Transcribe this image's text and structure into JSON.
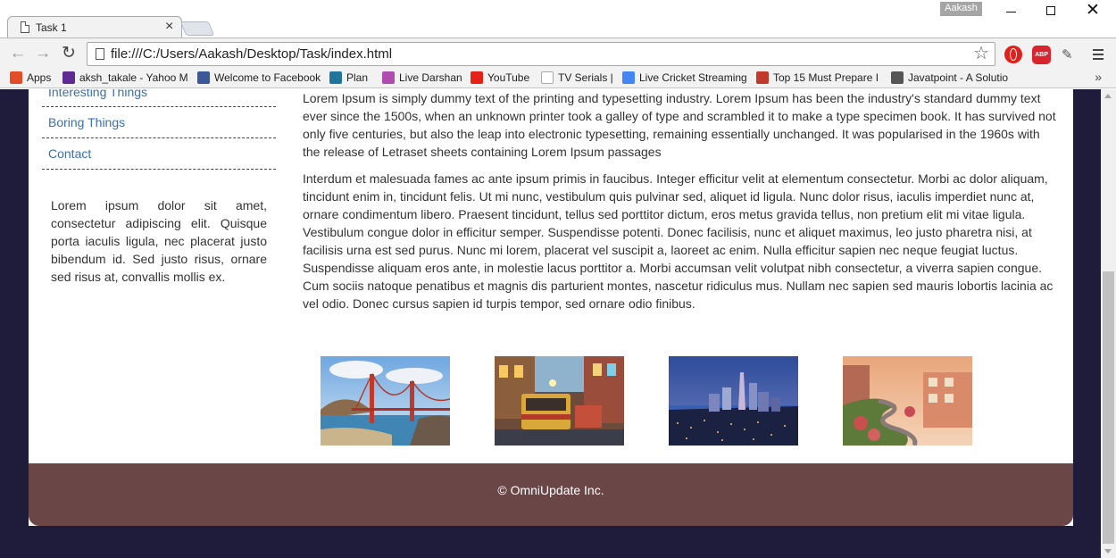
{
  "browser": {
    "tab_title": "Task 1",
    "profile_name": "Aakash",
    "url": "file:///C:/Users/Aakash/Desktop/Task/index.html",
    "bookmarks": [
      {
        "label": "Apps",
        "icon": "apps-grid-icon",
        "color": "#e34c26"
      },
      {
        "label": "aksh_takale - Yahoo M",
        "icon": "yahoo-mail-icon",
        "color": "#5f2a93"
      },
      {
        "label": "Welcome to Facebook",
        "icon": "facebook-icon",
        "color": "#3b5998"
      },
      {
        "label": "Plan",
        "icon": "wordpress-icon",
        "color": "#21759b"
      },
      {
        "label": "Live Darshan",
        "icon": "live-darshan-icon",
        "color": "#b04bb0"
      },
      {
        "label": "YouTube",
        "icon": "youtube-icon",
        "color": "#e62117"
      },
      {
        "label": "TV Serials |",
        "icon": "blank-page-icon",
        "color": "#ffffff"
      },
      {
        "label": "Live Cricket Streaming",
        "icon": "google-icon",
        "color": "#4285f4"
      },
      {
        "label": "Top 15 Must Prepare I",
        "icon": "java-icon",
        "color": "#c0392b"
      },
      {
        "label": "Javatpoint - A Solutio",
        "icon": "javatpoint-icon",
        "color": "#555555"
      }
    ]
  },
  "nav": {
    "items": [
      "Interesting Things",
      "Boring Things",
      "Contact"
    ]
  },
  "sidebar": {
    "text": "Lorem ipsum dolor sit amet, consectetur adipiscing elit. Quisque porta iaculis ligula, nec placerat justo bibendum id. Sed justo risus, ornare sed risus at, convallis mollis ex."
  },
  "main": {
    "paragraphs": [
      "Lorem Ipsum is simply dummy text of the printing and typesetting industry. Lorem Ipsum has been the industry's standard dummy text ever since the 1500s, when an unknown printer took a galley of type and scrambled it to make a type specimen book. It has survived not only five centuries, but also the leap into electronic typesetting, remaining essentially unchanged. It was popularised in the 1960s with the release of Letraset sheets containing Lorem Ipsum passages",
      "Interdum et malesuada fames ac ante ipsum primis in faucibus. Integer efficitur velit at elementum consectetur. Morbi ac dolor aliquam, tincidunt enim in, tincidunt felis. Ut mi nunc, vestibulum quis pulvinar sed, aliquet id ligula. Nunc dolor risus, iaculis imperdiet nunc at, ornare condimentum libero. Praesent tincidunt, tellus sed porttitor dictum, eros metus gravida tellus, non pretium elit mi vitae ligula. Vestibulum congue dolor in efficitur semper. Suspendisse potenti. Donec facilisis, nunc et aliquet maximus, leo justo pharetra nisi, at facilisis urna est sed purus. Nunc mi lorem, placerat vel suscipit a, laoreet ac enim. Nulla efficitur sapien nec neque feugiat luctus. Suspendisse aliquam eros ante, in molestie lacus porttitor a. Morbi accumsan velit volutpat nibh consectetur, a viverra sapien congue. Cum sociis natoque penatibus et magnis dis parturient montes, nascetur ridiculus mus. Nullam nec sapien sed mauris lobortis lacinia ac vel odio. Donec cursus sapien id turpis tempor, sed ornare odio finibus."
    ]
  },
  "photos": [
    {
      "name": "golden-gate-bridge-photo"
    },
    {
      "name": "cable-car-street-photo"
    },
    {
      "name": "city-skyline-night-photo"
    },
    {
      "name": "lombard-street-photo"
    }
  ],
  "footer": {
    "text": "© OmniUpdate Inc."
  },
  "colors": {
    "background": "#1e1c3a",
    "footer": "#6a4646",
    "link": "#3a6fb0"
  }
}
